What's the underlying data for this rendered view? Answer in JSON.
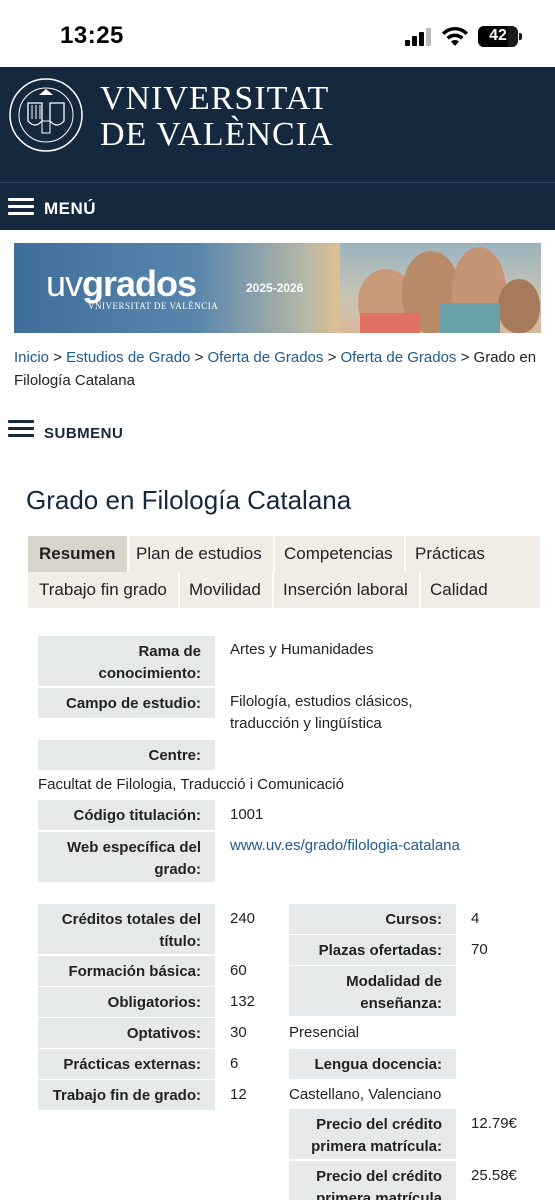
{
  "status_bar": {
    "time": "13:25",
    "battery": "42"
  },
  "header": {
    "brand_line1": "VNIVERSITAT",
    "brand_line2": "DE VALÈNCIA",
    "menu_label": "MENÚ"
  },
  "banner": {
    "logo_light": "uv",
    "logo_bold": "grados",
    "logo_sub": "VNIVERSITAT DE VALÈNCIA",
    "year": "2025-2026"
  },
  "breadcrumb": {
    "items": [
      "Inicio",
      "Estudios de Grado",
      "Oferta de Grados",
      "Oferta de Grados"
    ],
    "separator": ">",
    "current": "Grado en Filología Catalana"
  },
  "submenu_label": "SUBMENU",
  "page_title": "Grado en Filología Catalana",
  "tabs": [
    "Resumen",
    "Plan de estudios",
    "Competencias",
    "Prácticas",
    "Trabajo fin grado",
    "Movilidad",
    "Inserción laboral",
    "Calidad"
  ],
  "active_tab": "Resumen",
  "info": {
    "rama_label": "Rama de conocimiento:",
    "rama_value": "Artes y Humanidades",
    "campo_label": "Campo de estudio:",
    "campo_value": "Filología, estudios clásicos, traducción y lingüística",
    "centre_label": "Centre:",
    "centre_value": "Facultat de Filologia, Traducció i Comunicació",
    "codigo_label": "Código titulación:",
    "codigo_value": "1001",
    "web_label": "Web específica del grado:",
    "web_value": "www.uv.es/grado/filologia-catalana"
  },
  "credits": {
    "total_label": "Créditos totales del título:",
    "total_value": "240",
    "basica_label": "Formación básica:",
    "basica_value": "60",
    "oblig_label": "Obligatorios:",
    "oblig_value": "132",
    "opt_label": "Optativos:",
    "opt_value": "30",
    "pract_label": "Prácticas externas:",
    "pract_value": "6",
    "tfg_label": "Trabajo fin de grado:",
    "tfg_value": "12"
  },
  "course": {
    "cursos_label": "Cursos:",
    "cursos_value": "4",
    "plazas_label": "Plazas ofertadas:",
    "plazas_value": "70",
    "modalidad_label": "Modalidad de enseñanza:",
    "modalidad_value": "Presencial",
    "lengua_label": "Lengua docencia:",
    "lengua_value": "Castellano, Valenciano",
    "precio1_label": "Precio del crédito primera matrícula:",
    "precio1_value": "12.79€",
    "precio2_label": "Precio del crédito primera matrícula",
    "precio2_value": "25.58€"
  }
}
